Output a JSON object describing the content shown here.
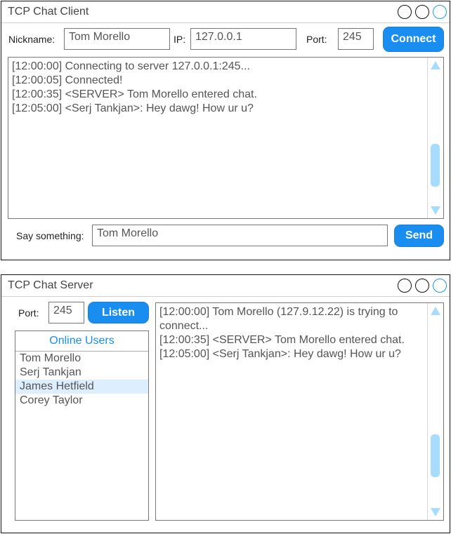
{
  "client": {
    "title": "TCP Chat Client",
    "nickname_label": "Nickname:",
    "nickname_value": "Tom Morello",
    "ip_label": "IP:",
    "ip_value": "127.0.0.1",
    "port_label": "Port:",
    "port_value": "245",
    "connect_label": "Connect",
    "log": [
      "[12:00:00] Connecting to server 127.0.0.1:245...",
      "[12:00:05] Connected!",
      "[12:00:35] <SERVER> Tom Morello entered chat.",
      "[12:05:00] <Serj Tankjan>: Hey dawg! How ur u?"
    ],
    "say_label": "Say something:",
    "say_value": "Tom Morello",
    "send_label": "Send"
  },
  "server": {
    "title": "TCP Chat Server",
    "port_label": "Port:",
    "port_value": "245",
    "listen_label": "Listen",
    "users_header": "Online Users",
    "users": [
      "Tom Morello",
      "Serj Tankjan",
      "James Hetfield",
      "Corey Taylor"
    ],
    "selected_user": "James Hetfield",
    "log": [
      "[12:00:00] Tom Morello (127.9.12.22) is trying to connect...",
      "[12:00:35] <SERVER> Tom Morello entered chat.",
      "[12:05:00] <Serj Tankjan>: Hey dawg! How ur u?"
    ]
  },
  "colors": {
    "accent": "#1a8ef0",
    "scrollbar": "#a7dcff",
    "selected_row": "#ddeeff"
  }
}
